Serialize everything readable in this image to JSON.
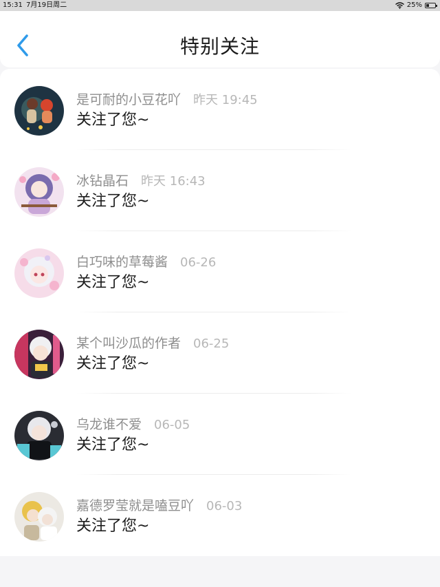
{
  "status_bar": {
    "time": "15:31",
    "date": "7月19日周二",
    "battery": "25%",
    "battery_level": 0.25,
    "icons": [
      "wifi-icon",
      "battery-icon"
    ]
  },
  "nav": {
    "back_icon": "chevron-left-icon",
    "title": "特别关注",
    "accent_color": "#2f9bea"
  },
  "items": [
    {
      "name": "是可耐的小豆花吖",
      "time": "昨天 19:45",
      "message": "关注了您~"
    },
    {
      "name": "冰钻晶石",
      "time": "昨天 16:43",
      "message": "关注了您~"
    },
    {
      "name": "白巧味的草莓酱",
      "time": "06-26",
      "message": "关注了您~"
    },
    {
      "name": "某个叫沙瓜的作者",
      "time": "06-25",
      "message": "关注了您~"
    },
    {
      "name": "乌龙谁不爱",
      "time": "06-05",
      "message": "关注了您~"
    },
    {
      "name": "嘉德罗莹就是嗑豆吖",
      "time": "06-03",
      "message": "关注了您~"
    }
  ]
}
